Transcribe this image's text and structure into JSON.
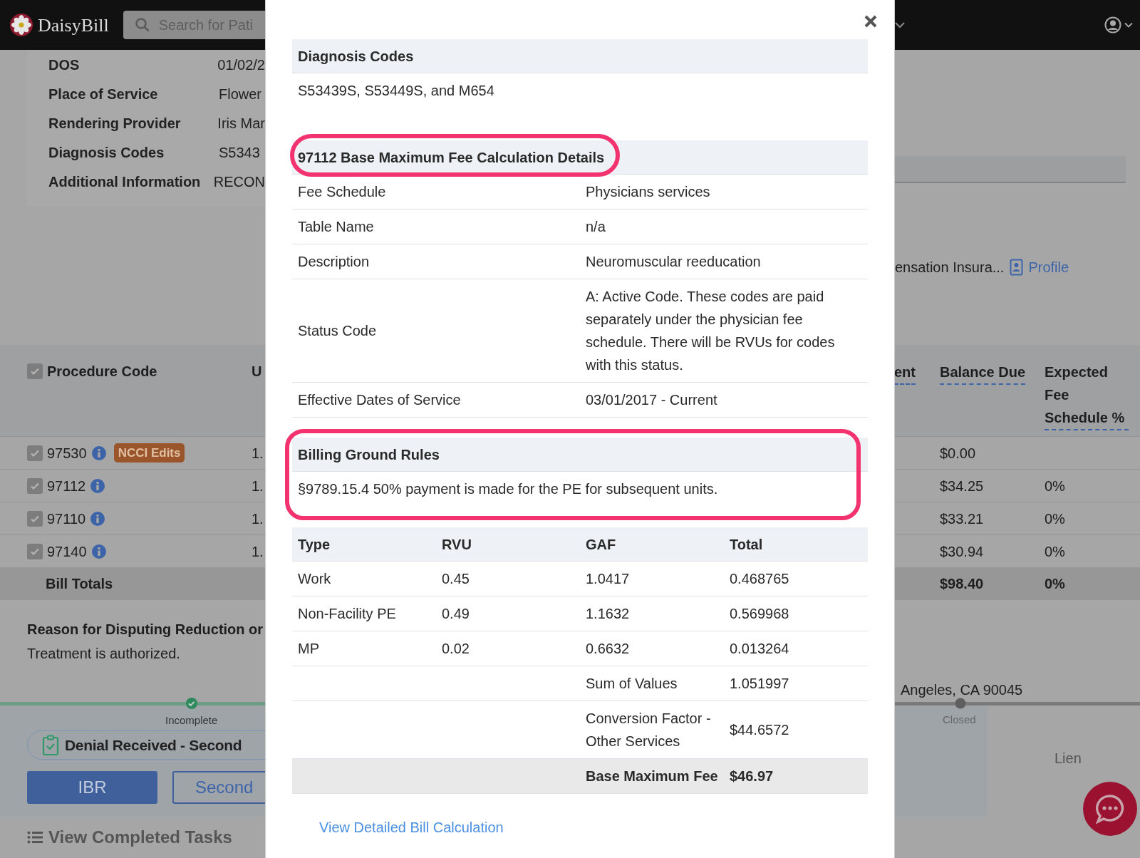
{
  "app_header": {
    "logo": "DaisyBill",
    "search": {
      "placeholder": "Search for Pati"
    }
  },
  "bill_details": [
    {
      "label": "DOS",
      "value": "01/02/2"
    },
    {
      "label": "Place of Service",
      "value": "Flower"
    },
    {
      "label": "Rendering Provider",
      "value": "Iris Mar"
    },
    {
      "label": "Diagnosis Codes",
      "value": "S5343"
    },
    {
      "label": "Additional Information",
      "value": "RECON"
    }
  ],
  "payer": {
    "text": "ensation Insura...",
    "profile_link": "Profile"
  },
  "procedure_table": {
    "header_checked": true,
    "columns_left": [
      "Procedure Code",
      "U"
    ],
    "columns_right": [
      "ent",
      "Balance Due",
      "Expected Fee Schedule %"
    ],
    "rows": [
      {
        "code": "97530",
        "checked": true,
        "badge": "NCCI Edits",
        "units": "1.",
        "balance_due": "$0.00"
      },
      {
        "code": "97112",
        "checked": true,
        "units": "1.",
        "balance_due": "$34.25",
        "expected_pct": "0%"
      },
      {
        "code": "97110",
        "checked": true,
        "units": "1.",
        "balance_due": "$33.21",
        "expected_pct": "0%"
      },
      {
        "code": "97140",
        "checked": true,
        "units": "1.",
        "balance_due": "$30.94",
        "expected_pct": "0%"
      }
    ],
    "totals": {
      "label": "Bill Totals",
      "balance_due": "$98.40",
      "expected_pct": "0%"
    }
  },
  "reason": {
    "label": "Reason for Disputing Reduction or",
    "text": "Treatment is authorized."
  },
  "address": "Angeles, CA 90045",
  "progress": [
    {
      "label": "Incomplete",
      "done": true
    },
    {
      "label": "Closed",
      "done": false
    }
  ],
  "task": {
    "title": "Denial Received - Second",
    "buttons": [
      {
        "label": "IBR",
        "kind": "primary"
      },
      {
        "label": "Second",
        "kind": "outline"
      }
    ],
    "lien_label": "Lien"
  },
  "completed_tasks_link": "View Completed Tasks",
  "modal": {
    "diagnosis": {
      "title": "Diagnosis Codes",
      "text": "S53439S, S53449S, and M654"
    },
    "fee_details": {
      "title": "97112 Base Maximum Fee Calculation Details",
      "highlighted": true,
      "rows": [
        {
          "label": "Fee Schedule",
          "value": "Physicians services"
        },
        {
          "label": "Table Name",
          "value": "n/a"
        },
        {
          "label": "Description",
          "value": "Neuromuscular reeducation"
        },
        {
          "label": "Status Code",
          "value": "A: Active Code. These codes are paid separately under the physician fee schedule. There will be RVUs for codes with this status."
        },
        {
          "label": "Effective Dates of Service",
          "value": "03/01/2017 - Current"
        }
      ]
    },
    "ground_rules": {
      "title": "Billing Ground Rules",
      "text": "§9789.15.4 50% payment is made for the PE for subsequent units.",
      "highlighted": true
    },
    "rvu_table": {
      "columns": [
        "Type",
        "RVU",
        "GAF",
        "Total"
      ],
      "rows": [
        [
          "Work",
          "0.45",
          "1.0417",
          "0.468765"
        ],
        [
          "Non-Facility PE",
          "0.49",
          "1.1632",
          "0.569968"
        ],
        [
          "MP",
          "0.02",
          "0.6632",
          "0.013264"
        ]
      ],
      "summary": [
        {
          "label": "Sum of Values",
          "value": "1.051997",
          "kind": "plain"
        },
        {
          "label": "Conversion Factor - Other Services",
          "value": "$44.6572",
          "kind": "plain"
        },
        {
          "label": "Base Maximum Fee",
          "value": "$46.97",
          "kind": "total"
        }
      ]
    },
    "link": "View Detailed Bill Calculation"
  }
}
